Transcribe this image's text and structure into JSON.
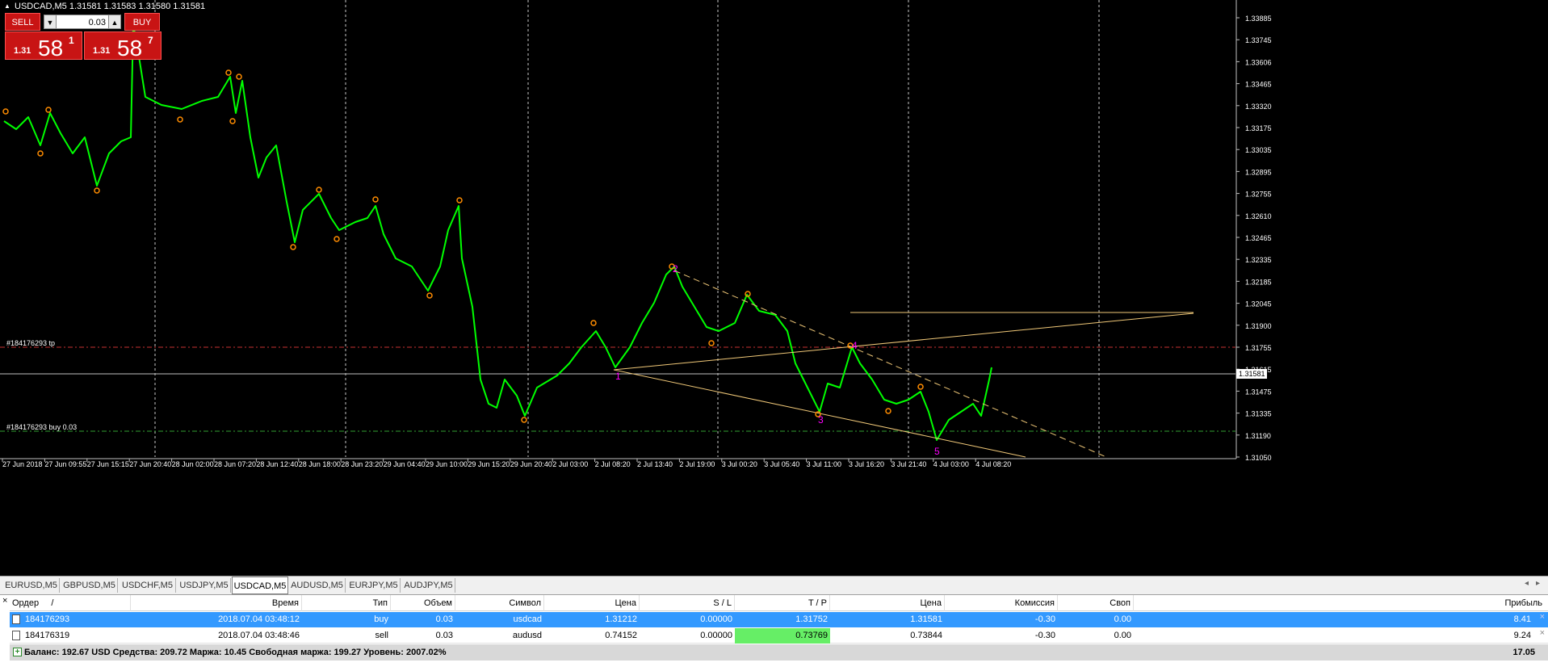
{
  "chart": {
    "title": "USDCAD,M5  1.31581 1.31583 1.31580 1.31581",
    "symbol": "USDCAD,M5",
    "bid_line_price": "1.31581",
    "price_axis": [
      "1.33885",
      "1.33745",
      "1.33606",
      "1.33465",
      "1.33320",
      "1.33175",
      "1.33035",
      "1.32895",
      "1.32755",
      "1.32610",
      "1.32465",
      "1.32335",
      "1.32185",
      "1.32045",
      "1.31900",
      "1.31755",
      "1.31615",
      "1.31475",
      "1.31335",
      "1.31190",
      "1.31050"
    ],
    "time_axis": [
      "27 Jun 2018",
      "27 Jun 09:55",
      "27 Jun 15:15",
      "27 Jun 20:40",
      "28 Jun 02:00",
      "28 Jun 07:20",
      "28 Jun 12:40",
      "28 Jun 18:00",
      "28 Jun 23:20",
      "29 Jun 04:40",
      "29 Jun 10:00",
      "29 Jun 15:20",
      "29 Jun 20:40",
      "2 Jul 03:00",
      "2 Jul 08:20",
      "2 Jul 13:40",
      "2 Jul 19:00",
      "3 Jul 00:20",
      "3 Jul 05:40",
      "3 Jul 11:00",
      "3 Jul 16:20",
      "3 Jul 21:40",
      "4 Jul 03:00",
      "4 Jul 08:20"
    ],
    "tp_label": "#184176293 tp",
    "buy_label": "#184176293 buy 0.03",
    "wave_labels": [
      "1",
      "2",
      "3",
      "4",
      "5"
    ],
    "colors": {
      "candles": "#00ff00",
      "trendline": "#f0c878",
      "tp_line": "#c83232",
      "buy_line": "#32a032",
      "bid_line": "#c0c0c0",
      "wave": "#ff00ff",
      "fractal": "#ff8c00"
    }
  },
  "oneclick": {
    "sell_label": "SELL",
    "buy_label": "BUY",
    "volume": "0.03",
    "sell_prefix": "1.31",
    "sell_big": "58",
    "sell_sup": "1",
    "buy_prefix": "1.31",
    "buy_big": "58",
    "buy_sup": "7"
  },
  "tabs": [
    "EURUSD,M5",
    "GBPUSD,M5",
    "USDCHF,M5",
    "USDJPY,M5",
    "USDCAD,M5",
    "AUDUSD,M5",
    "EURJPY,M5",
    "AUDJPY,M5"
  ],
  "active_tab": "USDCAD,M5",
  "terminal": {
    "headers": {
      "order": "Ордер",
      "sort": "/",
      "time": "Время",
      "type": "Тип",
      "volume": "Объем",
      "symbol": "Символ",
      "price": "Цена",
      "sl": "S / L",
      "tp": "T / P",
      "cur_price": "Цена",
      "commission": "Комиссия",
      "swap": "Своп",
      "profit": "Прибыль"
    },
    "rows": [
      {
        "order": "184176293",
        "time": "2018.07.04 03:48:12",
        "type": "buy",
        "volume": "0.03",
        "symbol": "usdcad",
        "price": "1.31212",
        "sl": "0.00000",
        "tp": "1.31752",
        "cur_price": "1.31581",
        "commission": "-0.30",
        "swap": "0.00",
        "profit": "8.41"
      },
      {
        "order": "184176319",
        "time": "2018.07.04 03:48:46",
        "type": "sell",
        "volume": "0.03",
        "symbol": "audusd",
        "price": "0.74152",
        "sl": "0.00000",
        "tp": "0.73769",
        "cur_price": "0.73844",
        "commission": "-0.30",
        "swap": "0.00",
        "profit": "9.24"
      }
    ],
    "balance_text": "Баланс: 192.67 USD  Средства: 209.72  Маржа: 10.45  Свободная маржа: 199.27  Уровень: 2007.02%",
    "total_profit": "17.05"
  }
}
